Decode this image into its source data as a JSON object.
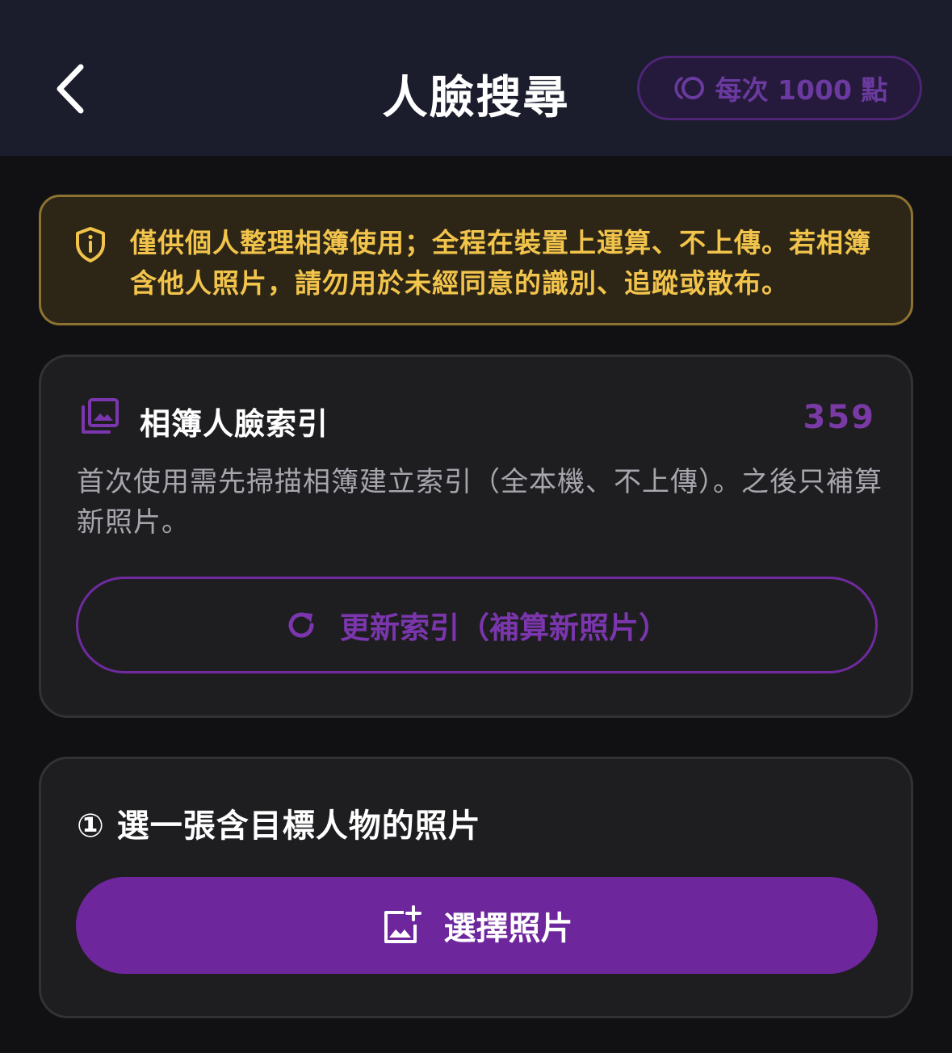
{
  "header": {
    "title": "人臉搜尋",
    "back_icon": "chevron-left-icon",
    "points_badge": {
      "icon": "coin-icon",
      "label": "每次 1000 點"
    }
  },
  "notice": {
    "icon": "shield-info-icon",
    "text": "僅供個人整理相簿使用；全程在裝置上運算、不上傳。若相簿含他人照片，請勿用於未經同意的識別、追蹤或散布。"
  },
  "index_card": {
    "icon": "photo-library-icon",
    "title": "相簿人臉索引",
    "count": "359",
    "description": "首次使用需先掃描相簿建立索引（全本機、不上傳）。之後只補算新照片。",
    "refresh_button": {
      "icon": "refresh-icon",
      "label": "更新索引（補算新照片）"
    }
  },
  "select_card": {
    "step_title": "① 選一張含目標人物的照片",
    "select_button": {
      "icon": "add-photo-icon",
      "label": "選擇照片"
    }
  },
  "colors": {
    "accent": "#6e269c",
    "warning": "#f2c44c",
    "header_bg": "#1b1c2c"
  }
}
